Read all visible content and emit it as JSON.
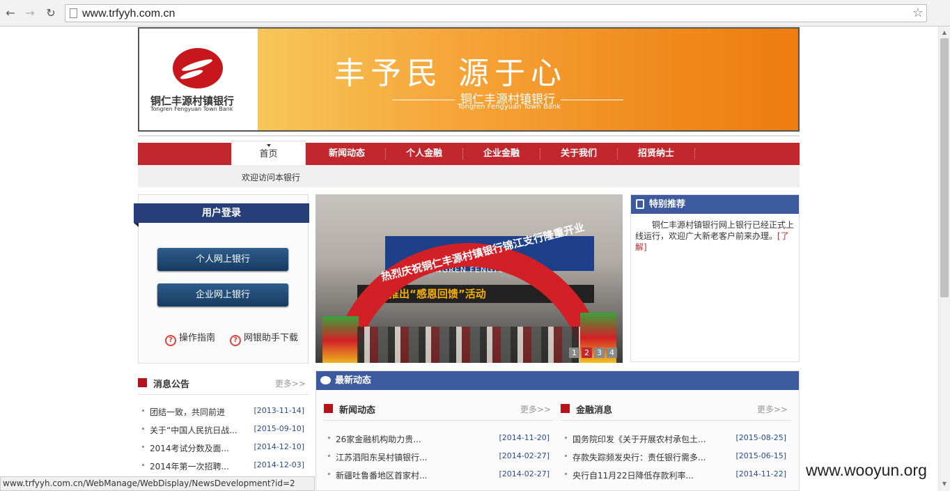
{
  "browser": {
    "url": "www.trfyyh.com.cn"
  },
  "banner": {
    "bank_name_cn": "铜仁丰源村镇银行",
    "bank_name_en": "Tongren Fengyuan Town Bank",
    "slogan": "丰予民  源于心",
    "slogan_sub": "铜仁丰源村镇银行",
    "slogan_en": "Tongren Fengyuan Town Bank"
  },
  "nav": {
    "items": [
      {
        "label": "首页",
        "active": true
      },
      {
        "label": "新闻动态"
      },
      {
        "label": "个人金融"
      },
      {
        "label": "企业金融"
      },
      {
        "label": "关于我们"
      },
      {
        "label": "招贤纳士"
      }
    ],
    "welcome": "欢迎访问本银行"
  },
  "login": {
    "title": "用户登录",
    "personal_btn": "个人网上银行",
    "corporate_btn": "企业网上银行",
    "guide_link": "操作指南",
    "download_link": "网银助手下载"
  },
  "slideshow": {
    "store_text": "TONGREN FENGYUAN    NK",
    "arch_text": "热烈庆祝铜仁丰源村镇银行锦江支行隆重开业",
    "led_text": "特推出“感恩回馈”活动",
    "pages": [
      "1",
      "2",
      "3",
      "4"
    ],
    "current_page": 2
  },
  "recommend": {
    "title": "特别推荐",
    "body": "铜仁丰源村镇银行网上银行已经正式上线运行，欢迎广大新老客户前来办理。",
    "more": "[了解]"
  },
  "notice": {
    "title": "消息公告",
    "more": "更多>>",
    "items": [
      {
        "title": "团结一致，共同前进",
        "date": "[2013-11-14]"
      },
      {
        "title": "关于“中国人民抗日战...",
        "date": "[2015-09-10]"
      },
      {
        "title": "2014考试分数及面...",
        "date": "[2014-12-10]"
      },
      {
        "title": "2014年第一次招聘...",
        "date": "[2014-12-03]"
      }
    ]
  },
  "latest": {
    "title": "最新动态",
    "news": {
      "title": "新闻动态",
      "more": "更多>>",
      "items": [
        {
          "title": "26家金融机构助力贵...",
          "date": "[2014-11-20]"
        },
        {
          "title": "江苏泗阳东吴村镇银行...",
          "date": "[2014-02-27]"
        },
        {
          "title": "新疆吐鲁番地区首家村...",
          "date": "[2014-02-27]"
        }
      ]
    },
    "finance": {
      "title": "金融消息",
      "more": "更多>>",
      "items": [
        {
          "title": "国务院印发《关于开展农村承包土...",
          "date": "[2015-08-25]"
        },
        {
          "title": "存款失踪频发央行：责任银行需多...",
          "date": "[2015-06-15]"
        },
        {
          "title": "央行自11月22日降低存款利率...",
          "date": "[2014-11-22]"
        }
      ]
    }
  },
  "statusbar": "www.trfyyh.com.cn/WebManage/WebDisplay/NewsDevelopment?id=2",
  "watermark": "www.wooyun.org"
}
